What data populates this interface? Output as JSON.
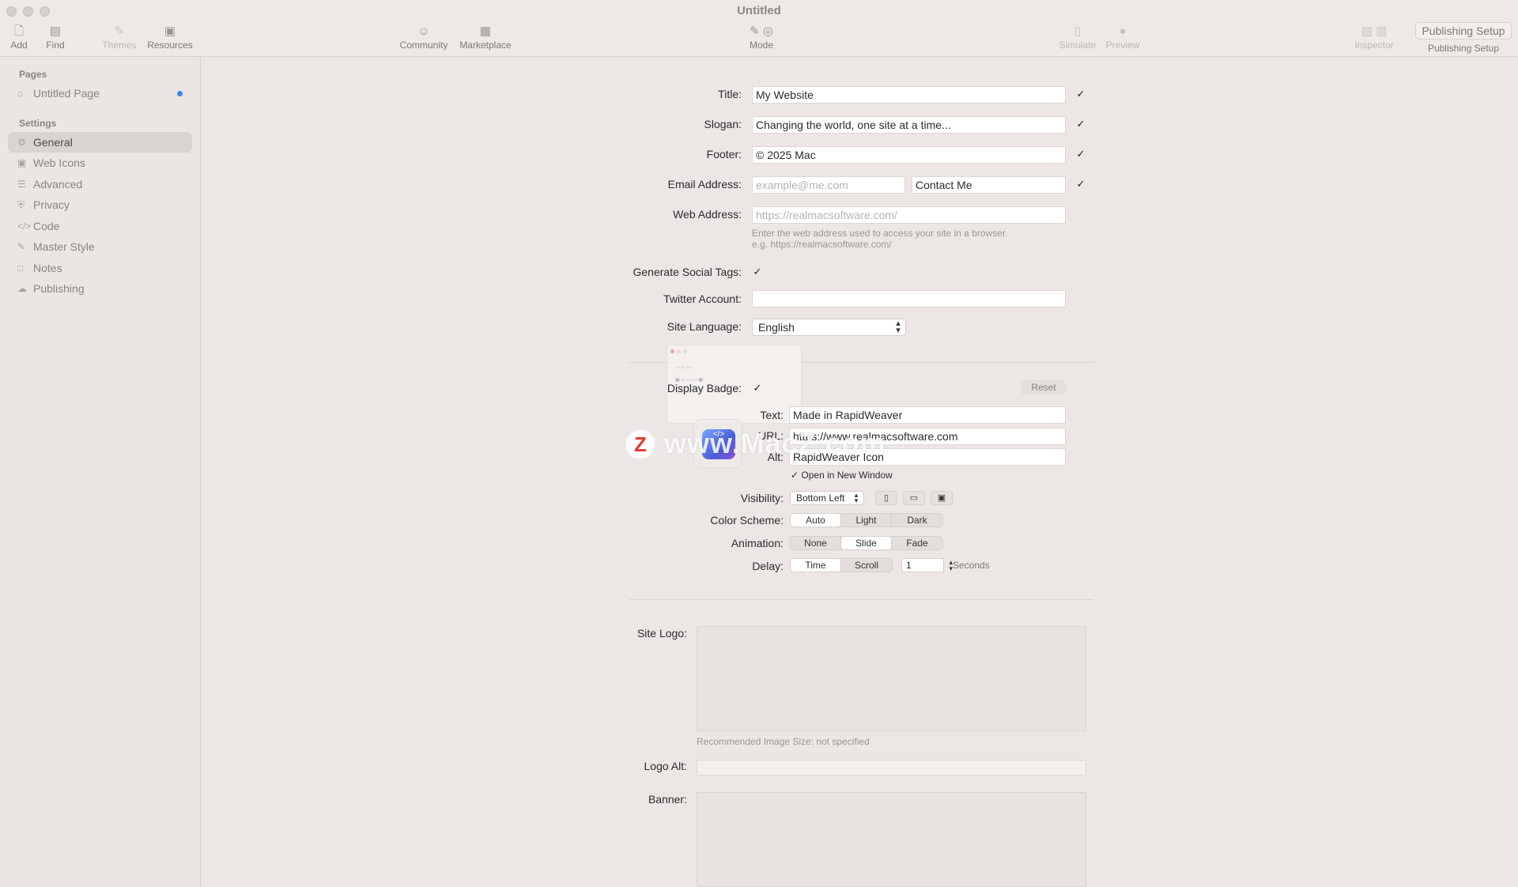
{
  "window": {
    "title": "Untitled"
  },
  "toolbar": {
    "add": "Add",
    "find": "Find",
    "themes": "Themes",
    "resources": "Resources",
    "community": "Community",
    "marketplace": "Marketplace",
    "mode": "Mode",
    "simulate": "Simulate",
    "preview": "Preview",
    "inspector": "Inspector",
    "publishing_setup_button": "Publishing Setup",
    "publishing_setup_label": "Publishing Setup"
  },
  "sidebar": {
    "pages_header": "Pages",
    "pages": [
      {
        "label": "Untitled Page",
        "icon": "house-icon"
      }
    ],
    "settings_header": "Settings",
    "settings": [
      {
        "label": "General",
        "icon": "gear-icon"
      },
      {
        "label": "Web Icons",
        "icon": "image-icon"
      },
      {
        "label": "Advanced",
        "icon": "sliders-icon"
      },
      {
        "label": "Privacy",
        "icon": "shield-icon"
      },
      {
        "label": "Code",
        "icon": "code-icon"
      },
      {
        "label": "Master Style",
        "icon": "brush-icon"
      },
      {
        "label": "Notes",
        "icon": "note-icon"
      },
      {
        "label": "Publishing",
        "icon": "cloud-icon"
      }
    ]
  },
  "form": {
    "title_label": "Title:",
    "title_value": "My Website",
    "slogan_label": "Slogan:",
    "slogan_value": "Changing the world, one site at a time...",
    "footer_label": "Footer:",
    "footer_value": "© 2025 Mac",
    "email_label": "Email Address:",
    "email_placeholder": "example@me.com",
    "email_link_text": "Contact Me",
    "web_label": "Web Address:",
    "web_placeholder": "https://realmacsoftware.com/",
    "web_hint_1": "Enter the web address used to access your site in a browser.",
    "web_hint_2": "e.g. https://realmacsoftware.com/",
    "social_label": "Generate Social Tags:",
    "twitter_label": "Twitter Account:",
    "twitter_value": "",
    "language_label": "Site Language:",
    "language_value": "English",
    "badge_label": "Display Badge:",
    "reset_label": "Reset",
    "badge_text_label": "Text:",
    "badge_text_value": "Made in RapidWeaver",
    "badge_url_label": "URL:",
    "badge_url_value": "https://www.realmacsoftware.com",
    "badge_alt_label": "Alt:",
    "badge_alt_value": "RapidWeaver Icon",
    "open_new_window": "Open in New Window",
    "visibility_label": "Visibility:",
    "visibility_value": "Bottom Left",
    "color_scheme_label": "Color Scheme:",
    "color_scheme_options": [
      "Auto",
      "Light",
      "Dark"
    ],
    "color_scheme_selected": "Auto",
    "animation_label": "Animation:",
    "animation_options": [
      "None",
      "Slide",
      "Fade"
    ],
    "animation_selected": "Slide",
    "delay_label": "Delay:",
    "delay_options": [
      "Time",
      "Scroll"
    ],
    "delay_selected": "Time",
    "delay_value": "1",
    "delay_unit": "Seconds",
    "site_logo_label": "Site Logo:",
    "site_logo_hint": "Recommended Image Size: not specified",
    "logo_alt_label": "Logo Alt:",
    "banner_label": "Banner:"
  },
  "watermark": {
    "text": "www.MacZ.com",
    "badge": "Z"
  },
  "colors": {
    "accent": "#3b82f6",
    "background": "#ece7e4"
  }
}
